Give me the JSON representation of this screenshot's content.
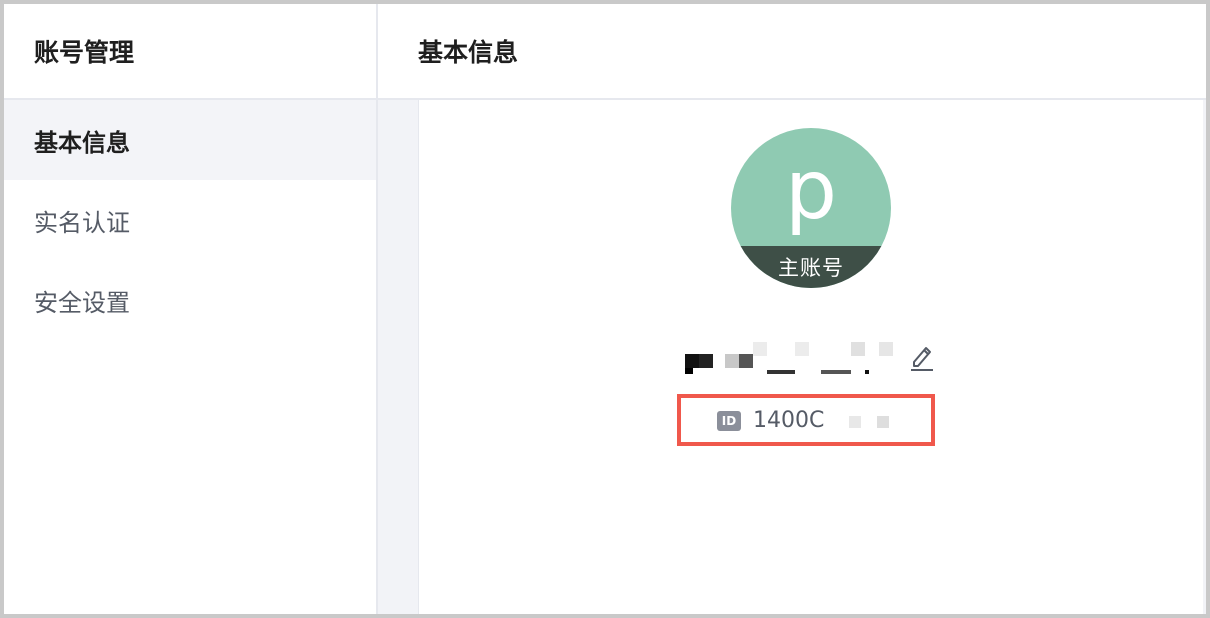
{
  "sidebar": {
    "title": "账号管理",
    "items": [
      {
        "label": "基本信息",
        "active": true
      },
      {
        "label": "实名认证",
        "active": false
      },
      {
        "label": "安全设置",
        "active": false
      }
    ]
  },
  "main": {
    "title": "基本信息"
  },
  "profile": {
    "avatar_letter": "p",
    "account_badge": "主账号",
    "account_name": "",
    "id_icon": "ID",
    "id_value": "1400C"
  },
  "colors": {
    "avatar_bg": "#8fcab2",
    "badge_bg": "#3e4f47",
    "highlight": "#f0584c",
    "active_bg": "#f3f4f8"
  },
  "icons": {
    "edit": "pencil-icon",
    "id": "id-badge-icon"
  }
}
